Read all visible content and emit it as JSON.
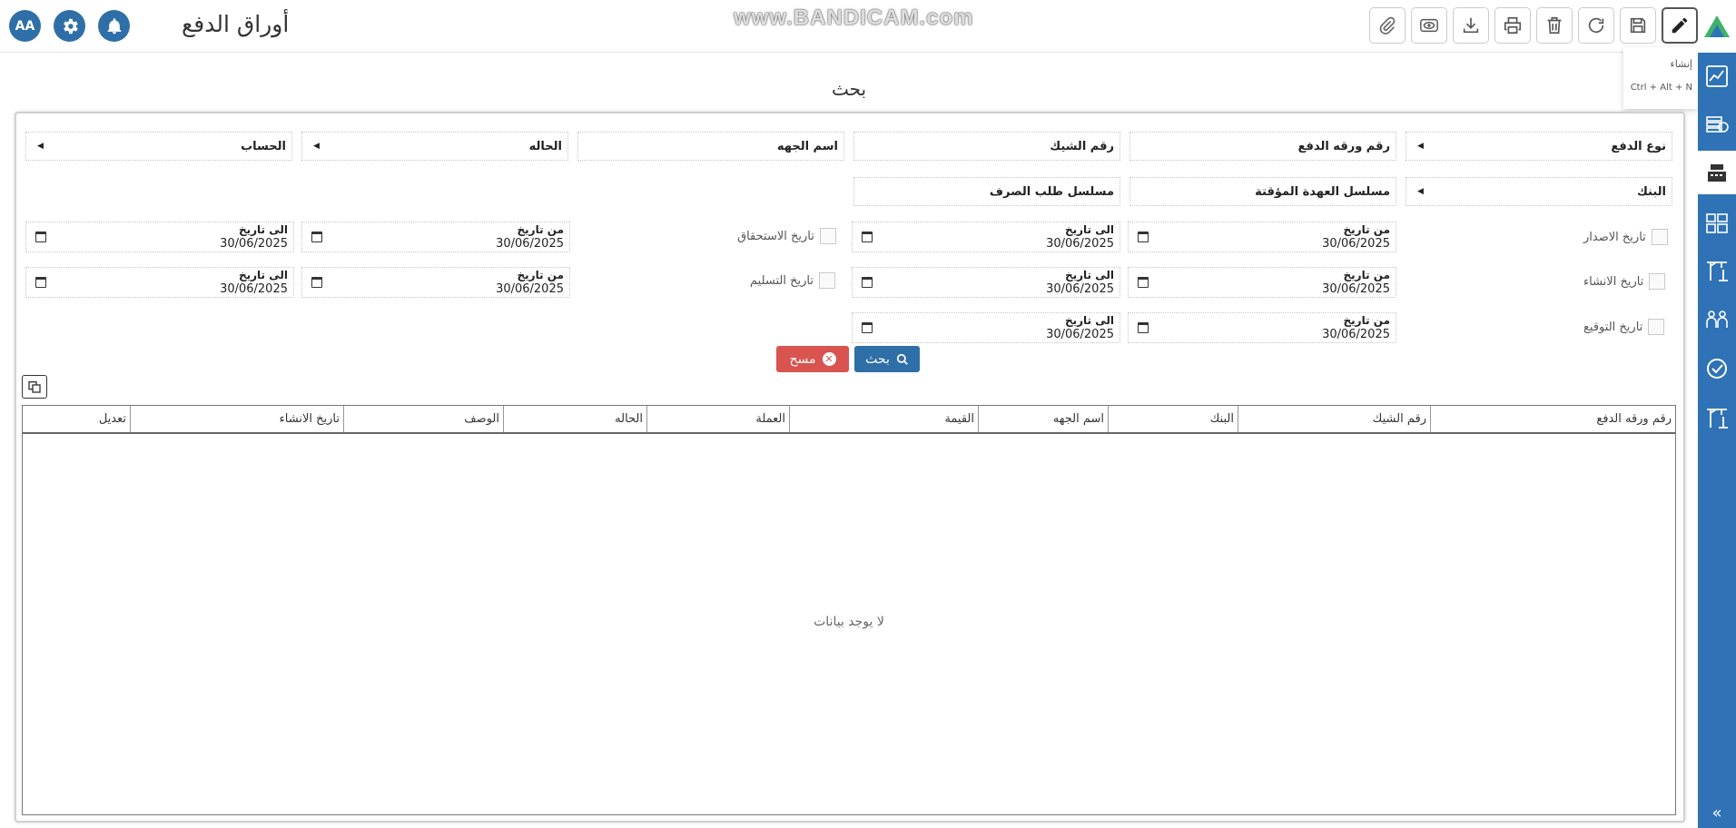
{
  "header": {
    "title": "أوراق الدفع",
    "watermark": "www.BANDICAM.com",
    "avatar_initials": "AA"
  },
  "tooltip": {
    "title": "إنشاء",
    "shortcut": "Ctrl + Alt + N"
  },
  "search": {
    "title": "بحث",
    "row1": {
      "payment_type": "نوع الدفع",
      "payment_paper_no": "رقم ورقه الدفع",
      "check_no": "رقم الشيك",
      "party_name": "اسم الجهه",
      "status": "الحاله",
      "account": "الحساب"
    },
    "row2": {
      "bank": "البنك",
      "temp_custody_serial": "مسلسل العهدة المؤقتة",
      "disbursement_request_serial": "مسلسل طلب الصرف"
    },
    "dates": {
      "from_label": "من تاريخ",
      "to_label": "الى تاريخ",
      "value": "30/06/2025",
      "issue_date": "تاريخ الاصدار",
      "creation_date": "تاريخ الانشاء",
      "signing_date": "تاريخ التوقيع",
      "due_date": "تاريخ الاستحقاق",
      "delivery_date": "تاريخ التسليم"
    },
    "buttons": {
      "search": "بحث",
      "clear": "مسح"
    }
  },
  "grid": {
    "columns": [
      "رقم ورقه الدفع",
      "رقم الشيك",
      "البنك",
      "اسم الجهه",
      "القيمة",
      "العملة",
      "الحاله",
      "الوصف",
      "تاريخ الانشاء",
      "تعديل"
    ],
    "empty_text": "لا يوجد بيانات"
  },
  "colors": {
    "primary": "#2f6fa8",
    "sidebar": "#2f73b6",
    "danger": "#d9534f"
  }
}
